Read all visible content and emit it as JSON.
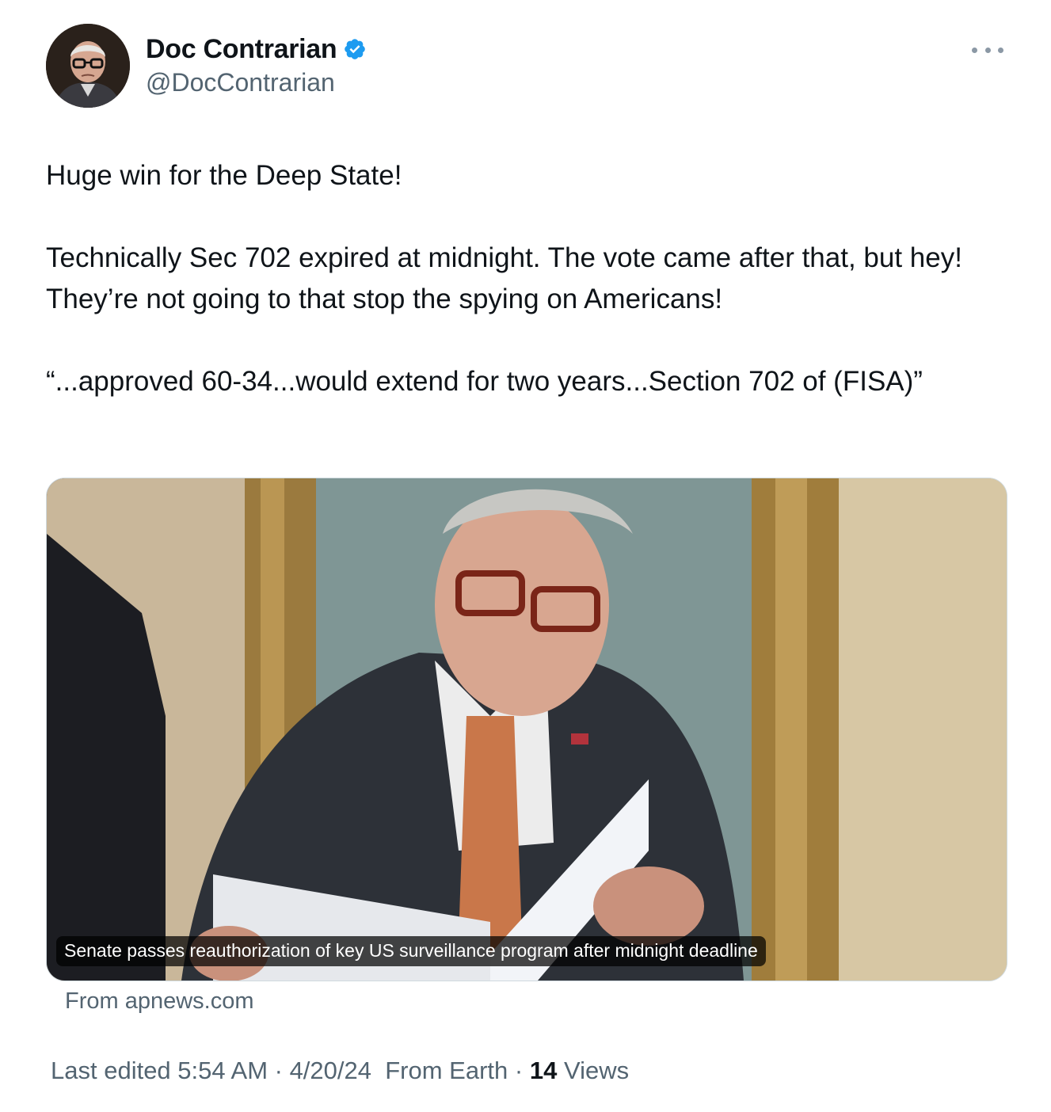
{
  "author": {
    "display_name": "Doc Contrarian",
    "handle": "@DocContrarian",
    "verified": true
  },
  "icons": {
    "verified": "verified-badge-icon",
    "more": "more-horizontal-icon",
    "verified_color": "#1d9bf0"
  },
  "tweet": {
    "paragraph_1": "Huge win for the Deep State!",
    "paragraph_2": "Technically Sec 702 expired at midnight. The vote came after that, but hey! They’re not going to that stop the spying on Americans!",
    "paragraph_3": "“...approved 60-34...would extend for two years...Section 702 of (FISA)”"
  },
  "card": {
    "headline": "Senate passes reauthorization of key US surveillance program after midnight deadline",
    "source": "From apnews.com"
  },
  "meta": {
    "edited": "Last edited 5:54 AM · 4/20/24",
    "location": "From Earth",
    "separator": "·",
    "views_count": "14",
    "views_label": "Views"
  }
}
